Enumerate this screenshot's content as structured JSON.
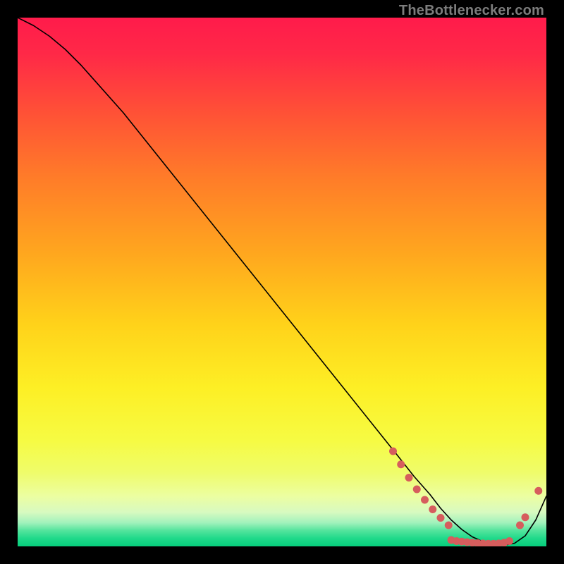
{
  "watermark": "TheBottlenecker.com",
  "chart_data": {
    "type": "line",
    "title": "",
    "xlabel": "",
    "ylabel": "",
    "xlim": [
      0,
      100
    ],
    "ylim": [
      0,
      100
    ],
    "grid": false,
    "background_gradient": {
      "stops": [
        {
          "offset": 0.0,
          "color": "#ff1b4b"
        },
        {
          "offset": 0.07,
          "color": "#ff2947"
        },
        {
          "offset": 0.18,
          "color": "#ff5136"
        },
        {
          "offset": 0.3,
          "color": "#ff7b29"
        },
        {
          "offset": 0.45,
          "color": "#ffa81e"
        },
        {
          "offset": 0.58,
          "color": "#ffd21a"
        },
        {
          "offset": 0.7,
          "color": "#fdef25"
        },
        {
          "offset": 0.8,
          "color": "#f6fb43"
        },
        {
          "offset": 0.86,
          "color": "#effc6a"
        },
        {
          "offset": 0.905,
          "color": "#ecfea1"
        },
        {
          "offset": 0.935,
          "color": "#d8fac0"
        },
        {
          "offset": 0.955,
          "color": "#a2f2bc"
        },
        {
          "offset": 0.97,
          "color": "#54e49d"
        },
        {
          "offset": 0.985,
          "color": "#1fd98a"
        },
        {
          "offset": 1.0,
          "color": "#07ce7c"
        }
      ]
    },
    "series": [
      {
        "name": "bottleneck-curve",
        "color": "#000000",
        "stroke_width": 1.6,
        "x": [
          0,
          3,
          6,
          9,
          12,
          20,
          30,
          40,
          50,
          60,
          68,
          72,
          75,
          78,
          80,
          82,
          84,
          86,
          88,
          90,
          92,
          94,
          96,
          98,
          100
        ],
        "y": [
          100,
          98.5,
          96.5,
          94,
          91,
          82,
          69.5,
          57,
          44.5,
          32,
          22,
          17,
          13.2,
          9.8,
          7.2,
          5.0,
          3.2,
          1.8,
          0.9,
          0.4,
          0.2,
          0.6,
          2.0,
          5.0,
          9.5
        ]
      }
    ],
    "markers": {
      "name": "highlight-dots",
      "color": "#d65d5d",
      "radius": 5.5,
      "points": [
        {
          "x": 71,
          "y": 18.0
        },
        {
          "x": 72.5,
          "y": 15.5
        },
        {
          "x": 74,
          "y": 13.0
        },
        {
          "x": 75.5,
          "y": 10.8
        },
        {
          "x": 77,
          "y": 8.8
        },
        {
          "x": 78.5,
          "y": 7.0
        },
        {
          "x": 80,
          "y": 5.4
        },
        {
          "x": 81.5,
          "y": 4.0
        },
        {
          "x": 82,
          "y": 1.2
        },
        {
          "x": 83,
          "y": 1.0
        },
        {
          "x": 84,
          "y": 0.9
        },
        {
          "x": 85,
          "y": 0.8
        },
        {
          "x": 86,
          "y": 0.7
        },
        {
          "x": 87,
          "y": 0.6
        },
        {
          "x": 88,
          "y": 0.55
        },
        {
          "x": 89,
          "y": 0.5
        },
        {
          "x": 90,
          "y": 0.5
        },
        {
          "x": 91,
          "y": 0.55
        },
        {
          "x": 92,
          "y": 0.7
        },
        {
          "x": 93,
          "y": 1.0
        },
        {
          "x": 95,
          "y": 4.0
        },
        {
          "x": 96,
          "y": 5.5
        },
        {
          "x": 98.5,
          "y": 10.5
        }
      ]
    }
  }
}
